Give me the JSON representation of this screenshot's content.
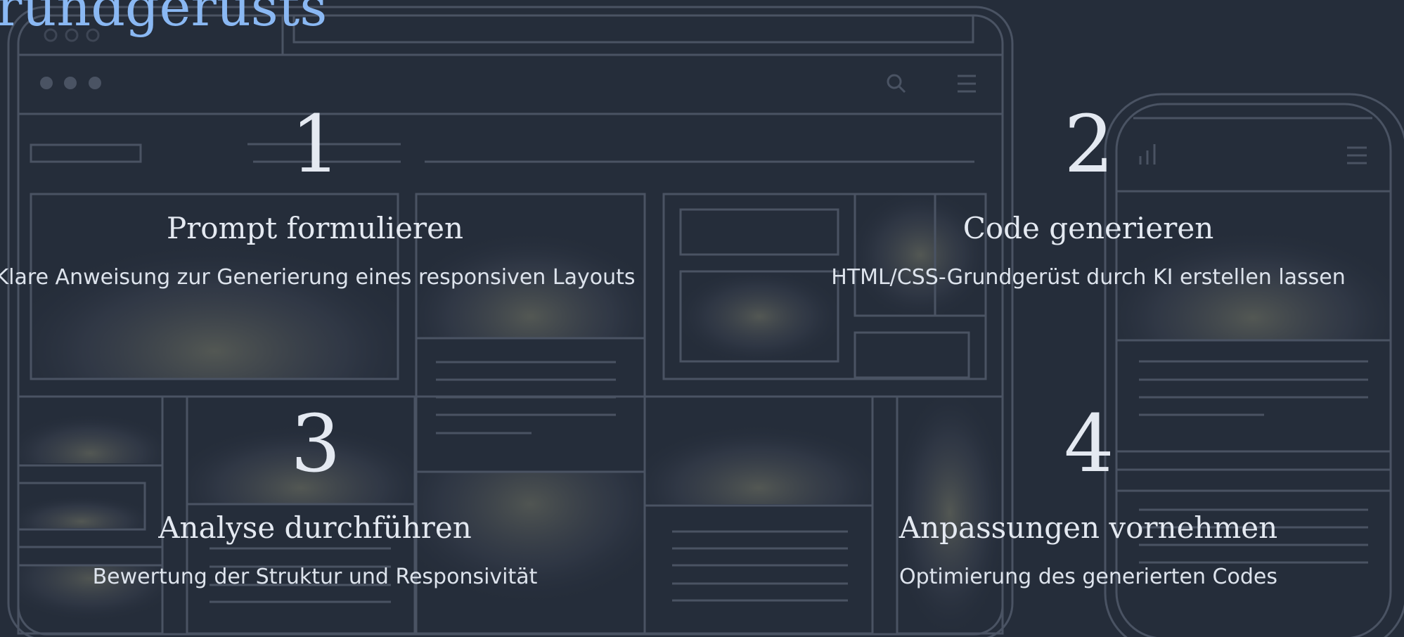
{
  "page": {
    "title": "rundgerüsts"
  },
  "steps": [
    {
      "number": "1",
      "title": "Prompt formulieren",
      "description": "Klare Anweisung zur Generierung eines responsiven Layouts"
    },
    {
      "number": "2",
      "title": "Code generieren",
      "description": "HTML/CSS-Grundgerüst durch KI erstellen lassen"
    },
    {
      "number": "3",
      "title": "Analyse durchführen",
      "description": "Bewertung der Struktur und Responsivität"
    },
    {
      "number": "4",
      "title": "Anpassungen vornehmen",
      "description": "Optimierung des generierten Codes"
    }
  ],
  "colors": {
    "background": "#252d3a",
    "title_accent": "#8ab8f3",
    "text": "#e4e9f1",
    "wireframe_line": "#4a5363"
  },
  "icons": {
    "desktop_search": "search-icon",
    "desktop_menu": "hamburger-menu-icon",
    "mobile_signal": "signal-icon",
    "mobile_menu": "hamburger-menu-icon"
  }
}
